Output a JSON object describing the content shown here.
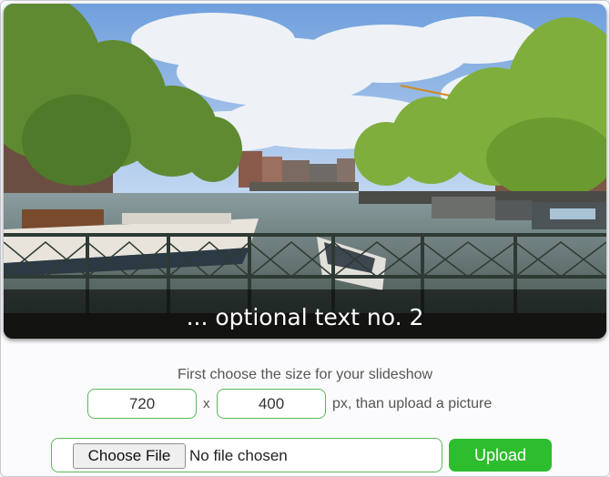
{
  "slideshow": {
    "image_alt": "Amsterdam canal with boats seen from a bridge",
    "caption": "... optional text no. 2"
  },
  "size_form": {
    "prompt": "First choose the size for your slideshow",
    "width_value": "720",
    "separator": "x",
    "height_value": "400",
    "note": "px, than upload a picture"
  },
  "upload": {
    "choose_label": "Choose File",
    "status": "No file chosen",
    "upload_label": "Upload"
  },
  "colors": {
    "accent_green": "#2ebd2e",
    "field_border": "#5cb85c"
  }
}
